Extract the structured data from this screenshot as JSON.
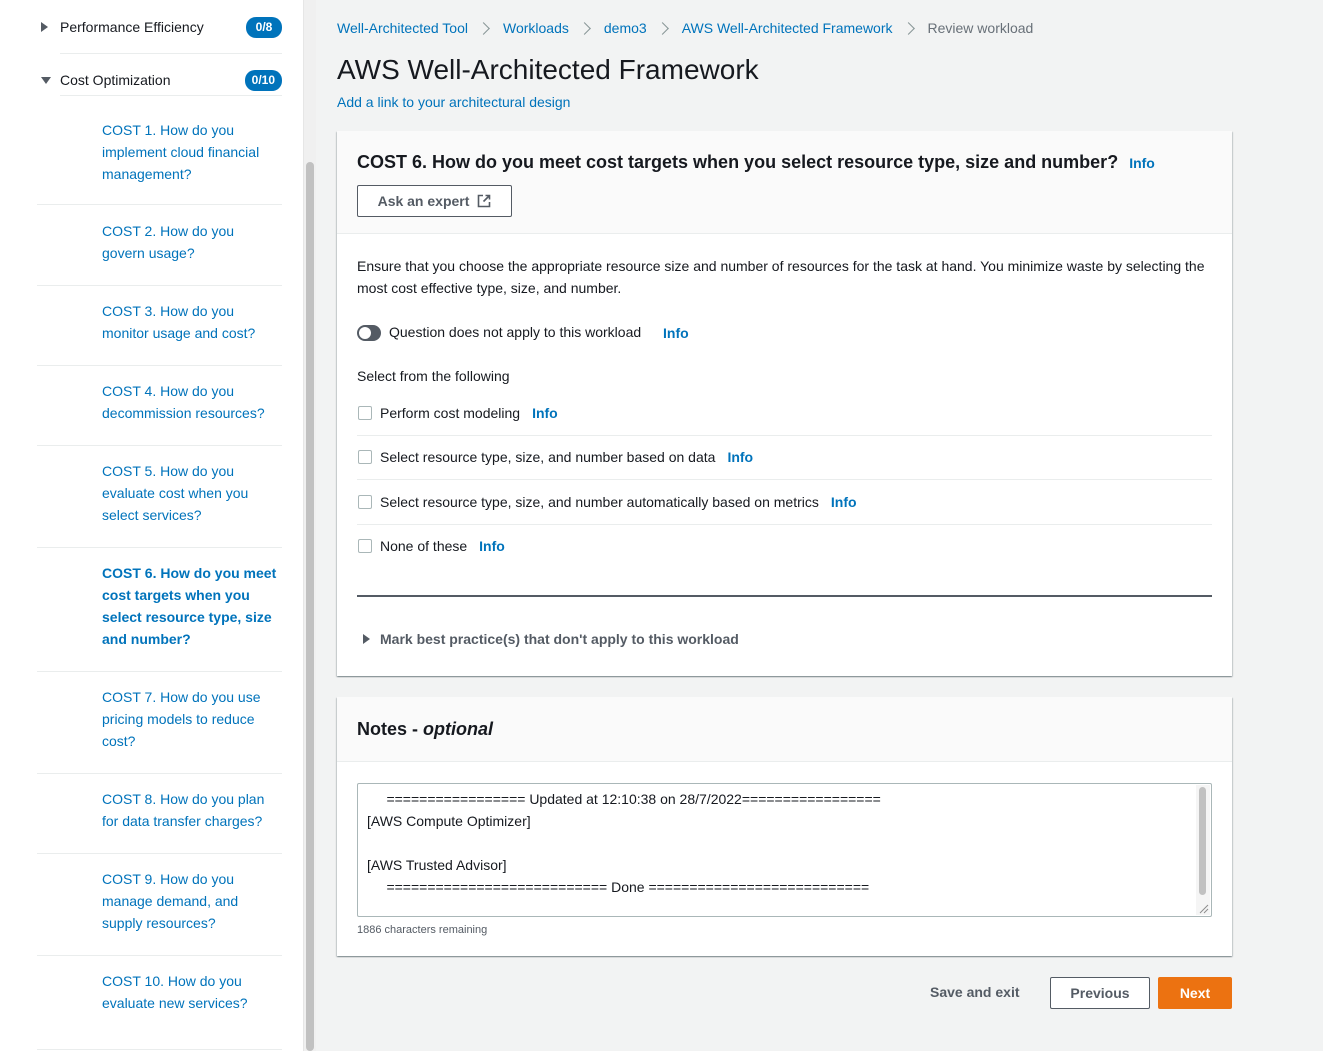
{
  "sidebar": {
    "pillars": [
      {
        "label": "Performance Efficiency",
        "badge": "0/8",
        "expanded": false
      },
      {
        "label": "Cost Optimization",
        "badge": "0/10",
        "expanded": true
      }
    ],
    "questions": [
      {
        "label": "COST 1. How do you implement cloud financial management?"
      },
      {
        "label": "COST 2. How do you govern usage?"
      },
      {
        "label": "COST 3. How do you monitor usage and cost?"
      },
      {
        "label": "COST 4. How do you decommission resources?"
      },
      {
        "label": "COST 5. How do you evaluate cost when you select services?"
      },
      {
        "label": "COST 6. How do you meet cost targets when you select resource type, size and number?"
      },
      {
        "label": "COST 7. How do you use pricing models to reduce cost?"
      },
      {
        "label": "COST 8. How do you plan for data transfer charges?"
      },
      {
        "label": "COST 9. How do you manage demand, and supply resources?"
      },
      {
        "label": "COST 10. How do you evaluate new services?"
      }
    ]
  },
  "breadcrumb": [
    {
      "label": "Well-Architected Tool"
    },
    {
      "label": "Workloads"
    },
    {
      "label": "demo3"
    },
    {
      "label": "AWS Well-Architected Framework"
    },
    {
      "label": "Review workload"
    }
  ],
  "page": {
    "title": "AWS Well-Architected Framework",
    "design_link": "Add a link to your architectural design"
  },
  "question": {
    "title": "COST 6. How do you meet cost targets when you select resource type, size and number?",
    "info": "Info",
    "ask_expert": "Ask an expert",
    "description": "Ensure that you choose the appropriate resource size and number of resources for the task at hand. You minimize waste by selecting the most cost effective type, size, and number.",
    "toggle_label": "Question does not apply to this workload",
    "select_label": "Select from the following",
    "choices": [
      {
        "label": "Perform cost modeling",
        "info": "Info"
      },
      {
        "label": "Select resource type, size, and number based on data",
        "info": "Info"
      },
      {
        "label": "Select resource type, size, and number automatically based on metrics",
        "info": "Info"
      },
      {
        "label": "None of these",
        "info": "Info"
      }
    ],
    "expander": "Mark best practice(s) that don't apply to this workload"
  },
  "notes": {
    "title": "Notes - ",
    "title_optional": "optional",
    "text": "     ================= Updated at 12:10:38 on 28/7/2022=================\n[AWS Compute Optimizer]\n\n[AWS Trusted Advisor]\n     =========================== Done ===========================",
    "chars_remaining": "1886 characters remaining"
  },
  "footer": {
    "save_exit": "Save and exit",
    "previous": "Previous",
    "next": "Next"
  },
  "colors": {
    "accent": "#0073bb",
    "primary_button": "#ec7211"
  }
}
